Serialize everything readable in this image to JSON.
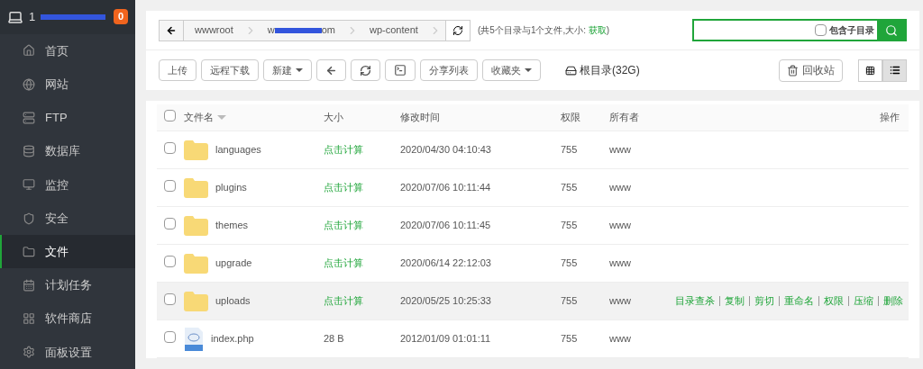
{
  "sidebar": {
    "host": "1",
    "badge": "0",
    "items": [
      {
        "kind": "home",
        "label": "首页",
        "selected": false
      },
      {
        "kind": "globe",
        "label": "网站",
        "selected": false
      },
      {
        "kind": "ftp",
        "label": "FTP",
        "selected": false
      },
      {
        "kind": "database",
        "label": "数据库",
        "selected": false
      },
      {
        "kind": "monitor",
        "label": "监控",
        "selected": false
      },
      {
        "kind": "shield",
        "label": "安全",
        "selected": false
      },
      {
        "kind": "folder",
        "label": "文件",
        "selected": true
      },
      {
        "kind": "task",
        "label": "计划任务",
        "selected": false
      },
      {
        "kind": "grid",
        "label": "软件商店",
        "selected": false
      },
      {
        "kind": "gear",
        "label": "面板设置",
        "selected": false
      }
    ]
  },
  "path": {
    "crumbs": [
      {
        "text": "wwwroot",
        "redacted": false
      },
      {
        "text": "w",
        "tail": "om",
        "redacted": true
      },
      {
        "text": "wp-content",
        "redacted": false
      }
    ],
    "summary": "(共5个目录与1个文件,大小: ",
    "summary_link": "获取",
    "summary_end": ")"
  },
  "search": {
    "subdir_label": "包含子目录",
    "subdir_checked": false
  },
  "toolbar": [
    {
      "kind": "text",
      "label": "上传"
    },
    {
      "kind": "text",
      "label": "远程下载"
    },
    {
      "kind": "menu",
      "label": "新建"
    },
    {
      "kind": "back"
    },
    {
      "kind": "refresh"
    },
    {
      "kind": "terminal"
    },
    {
      "kind": "text",
      "label": "分享列表"
    },
    {
      "kind": "menu",
      "label": "收藏夹"
    }
  ],
  "disk": "根目录(32G)",
  "recycle": "回收站",
  "views": [
    {
      "kind": "grid",
      "selected": false
    },
    {
      "kind": "list",
      "selected": true
    }
  ],
  "table": {
    "select_all_checked": false,
    "columns": [
      "文件名",
      "大小",
      "修改时间",
      "权限",
      "所有者",
      "操作"
    ],
    "rows": [
      {
        "kind": "folder",
        "name": "languages",
        "size": "点击计算",
        "modified": "2020/04/30 04:10:43",
        "perm": "755",
        "owner": "www",
        "checked": false,
        "hovered": false
      },
      {
        "kind": "folder",
        "name": "plugins",
        "size": "点击计算",
        "modified": "2020/07/06 10:11:44",
        "perm": "755",
        "owner": "www",
        "checked": false,
        "hovered": false
      },
      {
        "kind": "folder",
        "name": "themes",
        "size": "点击计算",
        "modified": "2020/07/06 10:11:45",
        "perm": "755",
        "owner": "www",
        "checked": false,
        "hovered": false
      },
      {
        "kind": "folder",
        "name": "upgrade",
        "size": "点击计算",
        "modified": "2020/06/14 22:12:03",
        "perm": "755",
        "owner": "www",
        "checked": false,
        "hovered": false
      },
      {
        "kind": "folder",
        "name": "uploads",
        "size": "点击计算",
        "modified": "2020/05/25 10:25:33",
        "perm": "755",
        "owner": "www",
        "checked": false,
        "hovered": true,
        "actions": [
          "目录查杀",
          "复制",
          "剪切",
          "重命名",
          "权限",
          "压缩",
          "删除"
        ]
      },
      {
        "kind": "file",
        "name": "index.php",
        "size": "28 B",
        "modified": "2012/01/09 01:01:11",
        "perm": "755",
        "owner": "www",
        "checked": false,
        "hovered": false
      }
    ]
  }
}
